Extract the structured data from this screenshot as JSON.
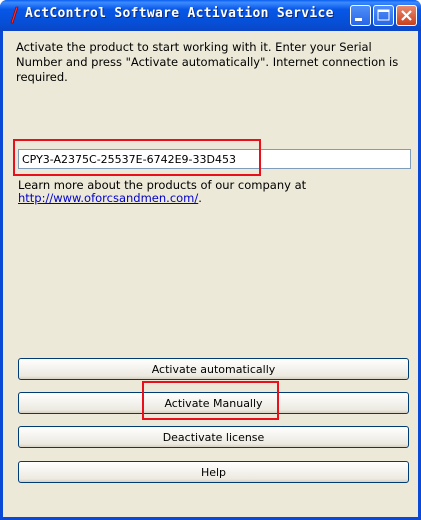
{
  "window": {
    "title": "ActControl Software Activation Service"
  },
  "instructions": "Activate the product to start working with it. Enter your Serial Number and press \"Activate automatically\". Internet connection is required.",
  "serial_field": {
    "value": "CPY3-A2375C-25537E-6742E9-33D453"
  },
  "learn_more": {
    "text": "Learn more about the products of our company at",
    "link": "http://www.oforcsandmen.com/",
    "suffix": "."
  },
  "buttons": {
    "activate_auto": "Activate automatically",
    "activate_manual": "Activate Manually",
    "deactivate": "Deactivate license",
    "help": "Help"
  },
  "colors": {
    "titlebar": "#0a5ef0",
    "face": "#ece9d8",
    "highlight": "#e8101b",
    "link": "#0000cc"
  }
}
